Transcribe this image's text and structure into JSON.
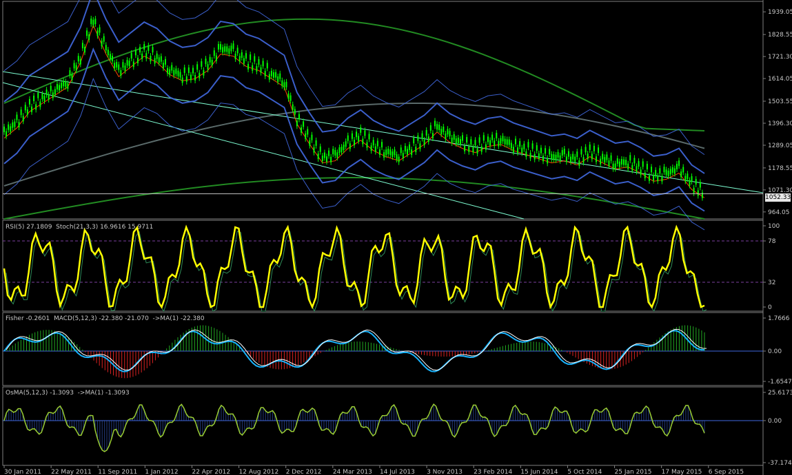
{
  "colors": {
    "background": "#000000",
    "grid": "#3a3a3a",
    "candle_up": "#00ff00",
    "price_line": "#c0c0c0",
    "bollinger": "#4169e1",
    "rsi": "#ffff00",
    "macd_signal": "#19b4ff",
    "osma": "#9acd32",
    "hist_up": "#22aa22",
    "hist_down": "#dd2222",
    "ma_long": "#228b22"
  },
  "price_pane": {
    "current_price": "1052.33",
    "y_ticks": [
      "1939.05",
      "1828.55",
      "1721.30",
      "1614.05",
      "1503.55",
      "1396.30",
      "1289.05",
      "1178.55",
      "1071.30",
      "964.05"
    ]
  },
  "rsi_pane": {
    "label": "RSI(5) 27.1809  Stoch(21,3,3) 16.9616 15.9711",
    "y_ticks": [
      "100",
      "78",
      "32",
      "0"
    ]
  },
  "fisher_pane": {
    "label": "Fisher -0.2601  MACD(5,12,3) -22.380 -21.070  ->MA(1) -22.380",
    "y_ticks": [
      "1.7666",
      "0.00",
      "-1.6547"
    ]
  },
  "osma_pane": {
    "label": "OsMA(5,12,3) -1.3093  ->MA(1) -1.3093",
    "y_ticks": [
      "25.6173",
      "0.00",
      "-37.1745"
    ]
  },
  "x_axis": {
    "labels": [
      "30 Jan 2011",
      "22 May 2011",
      "11 Sep 2011",
      "1 Jan 2012",
      "22 Apr 2012",
      "12 Aug 2012",
      "2 Dec 2012",
      "24 Mar 2013",
      "14 Jul 2013",
      "3 Nov 2013",
      "23 Feb 2014",
      "15 Jun 2014",
      "5 Oct 2014",
      "25 Jan 2015",
      "17 May 2015",
      "6 Sep 2015"
    ]
  },
  "chart_data": {
    "type": "line",
    "series": [
      {
        "name": "",
        "values": [
          1350,
          1400,
          1480,
          1520,
          1560,
          1600,
          1720,
          1900,
          1760,
          1650,
          1700,
          1750,
          1720,
          1660,
          1630,
          1640,
          1680,
          1760,
          1750,
          1700,
          1680,
          1640,
          1600,
          1420,
          1320,
          1230,
          1240,
          1300,
          1340,
          1290,
          1260,
          1240,
          1280,
          1320,
          1380,
          1330,
          1300,
          1280,
          1310,
          1320,
          1290,
          1270,
          1250,
          1230,
          1240,
          1220,
          1260,
          1230,
          1200,
          1210,
          1180,
          1140,
          1150,
          1180,
          1100,
          1060
        ]
      }
    ]
  }
}
